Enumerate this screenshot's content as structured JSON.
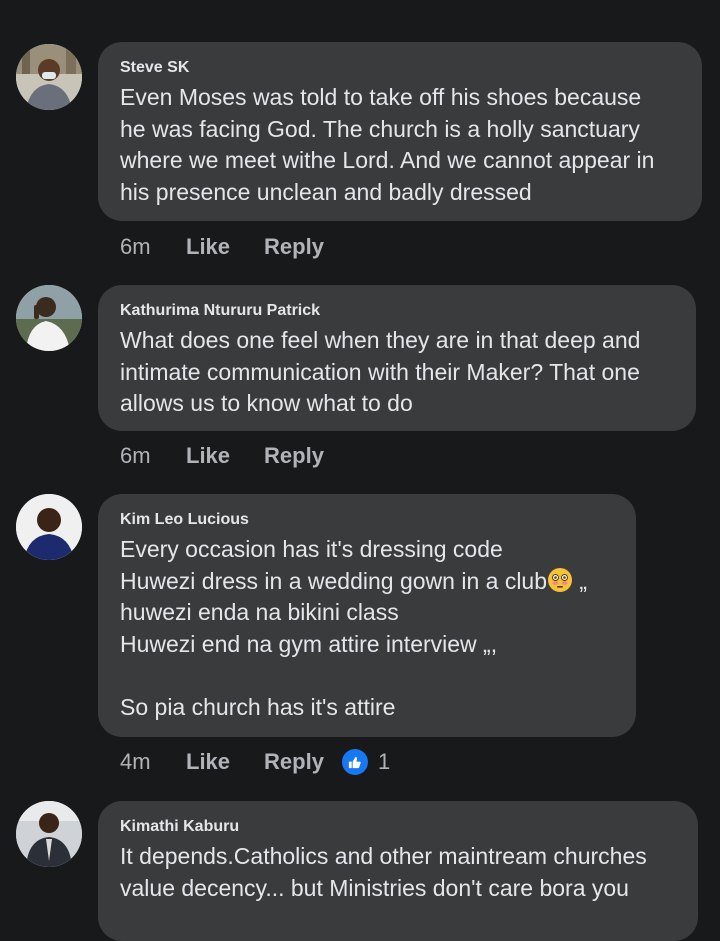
{
  "comments": [
    {
      "author": "Steve SK",
      "text": "Even Moses was told to take off his shoes because\nhe was facing God. The church is a holly sanctuary\nwhere we meet withe Lord. And we cannot appear in\nhis presence unclean and badly dressed",
      "time": "6m",
      "like_label": "Like",
      "reply_label": "Reply"
    },
    {
      "author": "Kathurima Ntururu Patrick",
      "text": "What does one feel when they are in that deep and\nintimate communication with their Maker? That one\nallows us to know what to do",
      "time": "6m",
      "like_label": "Like",
      "reply_label": "Reply"
    },
    {
      "author": "Kim Leo Lucious",
      "text_line1": "Every occasion has it's dressing code",
      "text_line2_before_emoji": "Huwezi dress in a wedding gown in a club",
      "text_line2_after_emoji": " „",
      "emoji_icon": "flushed-face-icon",
      "text_rest": "huwezi enda na bikini class\nHuwezi end na gym attire interview „,\n\nSo pia church has it's attire",
      "time": "4m",
      "like_label": "Like",
      "reply_label": "Reply",
      "reaction_count": "1",
      "reaction_icon": "thumbs-up-icon"
    },
    {
      "author": "Kimathi Kaburu",
      "text": "It depends.Catholics and other maintream churches\nvalue decency... but Ministries don't care bora you",
      "time": "",
      "like_label": "",
      "reply_label": ""
    }
  ],
  "colors": {
    "background": "#18191a",
    "bubble": "#3a3b3c",
    "primary_text": "#e4e6eb",
    "secondary_text": "#b0b3b8",
    "like_blue": "#1877f2"
  }
}
